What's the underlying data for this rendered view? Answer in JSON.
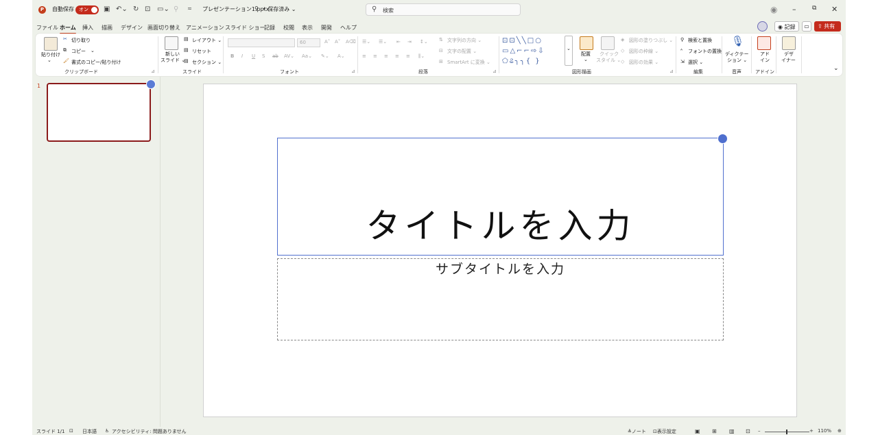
{
  "titlebar": {
    "autosave_label": "自動保存",
    "autosave_state": "オン",
    "file_name": "プレゼンテーション1.pptx",
    "save_state": "• 保存済み ⌄",
    "search_placeholder": "検索"
  },
  "tabs": [
    "ファイル",
    "ホーム",
    "挿入",
    "描画",
    "デザイン",
    "画面切り替え",
    "アニメーション",
    "スライド ショー",
    "記録",
    "校閲",
    "表示",
    "開発",
    "ヘルプ"
  ],
  "header_buttons": {
    "record": "◉ 記録",
    "share": "⇪ 共有 ⌄"
  },
  "ribbon": {
    "clipboard": {
      "paste": "貼り付け",
      "cut": "切り取り",
      "copy": "コピー",
      "format_painter": "書式のコピー/貼り付け",
      "label": "クリップボード"
    },
    "slides": {
      "new_slide_1": "新しい",
      "new_slide_2": "スライド ⌄",
      "layout": "レイアウト ⌄",
      "reset": "リセット",
      "section": "セクション ⌄",
      "label": "スライド"
    },
    "font": {
      "size_value": "60",
      "label": "フォント"
    },
    "paragraph": {
      "text_direction": "文字列の方向 ⌄",
      "align_text": "文字の配置 ⌄",
      "smartart": "SmartArt に変換 ⌄",
      "label": "段落"
    },
    "drawing": {
      "arrange": "配置",
      "quick_styles_1": "クイック",
      "quick_styles_2": "スタイル ⌄",
      "shape_fill": "図形の塗りつぶし ⌄",
      "shape_outline": "図形の枠線 ⌄",
      "shape_effects": "図形の効果 ⌄",
      "label": "図形描画"
    },
    "editing": {
      "find_replace": "検索と置換",
      "replace_font": "フォントの置換",
      "select": "選択 ⌄",
      "label": "編集"
    },
    "voice": {
      "dictate_1": "ディクテー",
      "dictate_2": "ション ⌄",
      "label": "音声"
    },
    "addins": {
      "addin_1": "アド",
      "addin_2": "イン",
      "label": "アドイン"
    },
    "designer": {
      "designer_1": "デザ",
      "designer_2": "イナー"
    }
  },
  "thumbnails": {
    "slide_number": "1"
  },
  "slide": {
    "title_placeholder": "タイトルを入力",
    "subtitle_placeholder": "サブタイトルを入力"
  },
  "statusbar": {
    "slide_counter": "スライド 1/1",
    "language": "日本語",
    "accessibility": "アクセシビリティ: 問題ありません",
    "notes": "≜ノート",
    "display_settings": "⊡表示設定",
    "zoom_level": "110%"
  },
  "colors": {
    "accent": "#c43e1c",
    "share": "#c42b1c",
    "placeholder_border": "#4f6fce",
    "thumb_border": "#8b1a1a"
  }
}
